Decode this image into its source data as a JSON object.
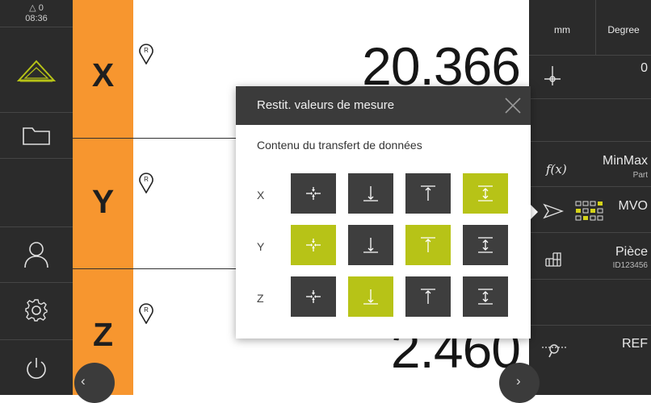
{
  "status": {
    "warning_count": "0",
    "time": "08:36"
  },
  "sidebar": {
    "items": [
      "measure",
      "file-management",
      "user-login",
      "settings",
      "power-off"
    ]
  },
  "axes": [
    {
      "label": "X",
      "value": "20.366"
    },
    {
      "label": "Y",
      "value": ""
    },
    {
      "label": "Z",
      "value": "2.460"
    }
  ],
  "pin_letter": "R",
  "right_panel": {
    "unit_length": "mm",
    "unit_angle": "Degree",
    "preset_value": "0",
    "minmax_label": "MinMax",
    "minmax_sub": "Part",
    "mvo_label": "MVO",
    "piece_label": "Pièce",
    "piece_id": "ID123456",
    "ref_label": "REF",
    "fx_label": "f(x)"
  },
  "nav": {
    "left_arrow": "‹",
    "right_arrow": "›"
  },
  "dialog": {
    "title": "Restit. valeurs de mesure",
    "subtitle": "Contenu du transfert de données",
    "rows": [
      {
        "label": "X",
        "options": [
          false,
          false,
          false,
          true
        ]
      },
      {
        "label": "Y",
        "options": [
          true,
          false,
          true,
          false
        ]
      },
      {
        "label": "Z",
        "options": [
          false,
          true,
          false,
          false
        ]
      }
    ],
    "option_kinds": [
      "actual-position",
      "min-value",
      "max-value",
      "range"
    ]
  },
  "colors": {
    "accent_orange": "#f7962f",
    "selected_green": "#b7c317",
    "dark": "#2b2b2b"
  }
}
